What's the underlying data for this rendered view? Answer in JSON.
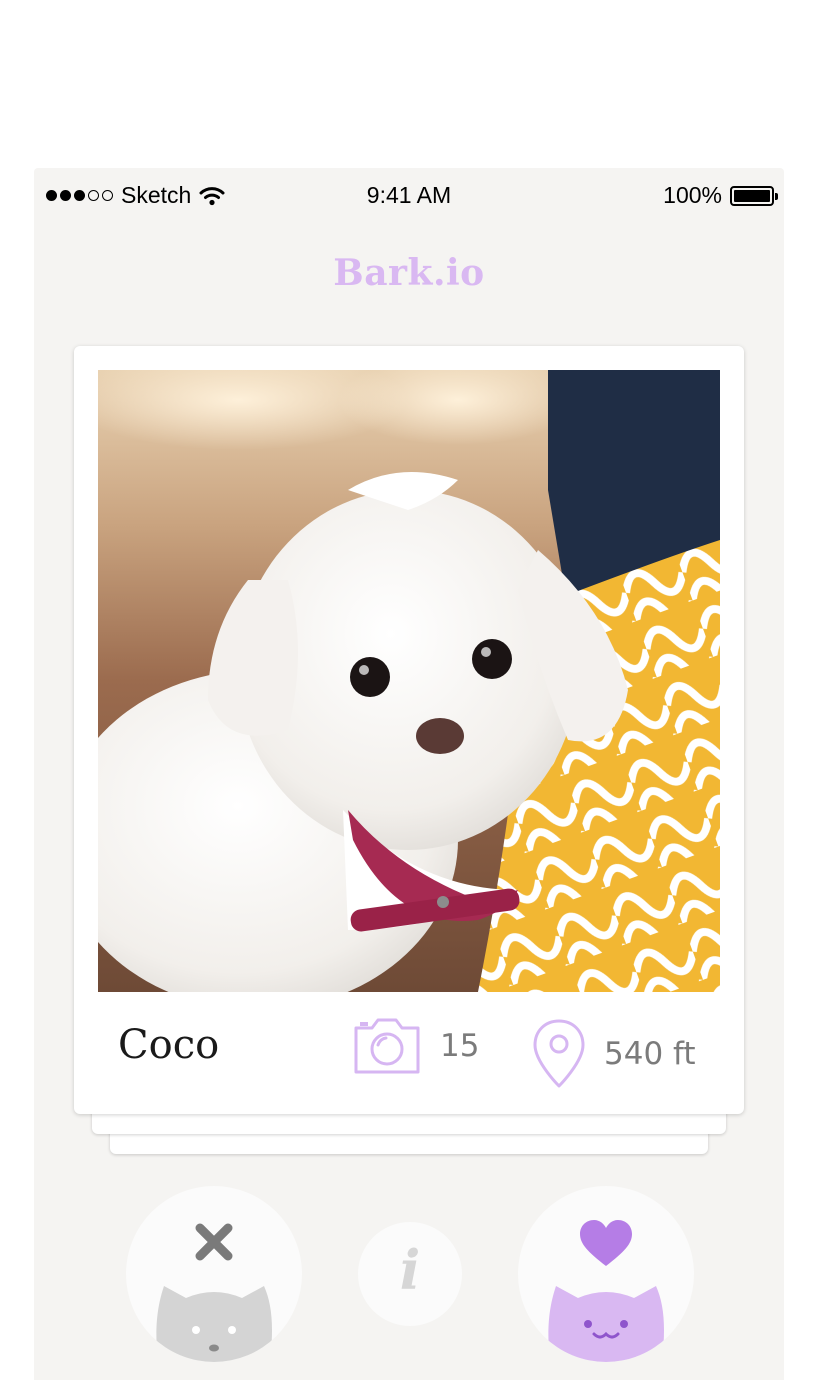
{
  "status_bar": {
    "carrier": "Sketch",
    "time": "9:41 AM",
    "battery": "100%",
    "signal_bars_filled": 3,
    "signal_bars_total": 5
  },
  "app": {
    "title": "Bark.io"
  },
  "card": {
    "name": "Coco",
    "photo_icon": "camera-icon",
    "photo_count": "15",
    "distance_icon": "location-pin-icon",
    "distance": "540 ft"
  },
  "actions": {
    "nope_icon": "close-icon",
    "info_icon": "info-icon",
    "like_icon": "heart-icon"
  },
  "colors": {
    "accent": "#d9b8f2",
    "accent_strong": "#b57de6",
    "background": "#f5f4f2",
    "muted_icon": "#d4d4d4",
    "close_icon": "#7a7a7a"
  }
}
